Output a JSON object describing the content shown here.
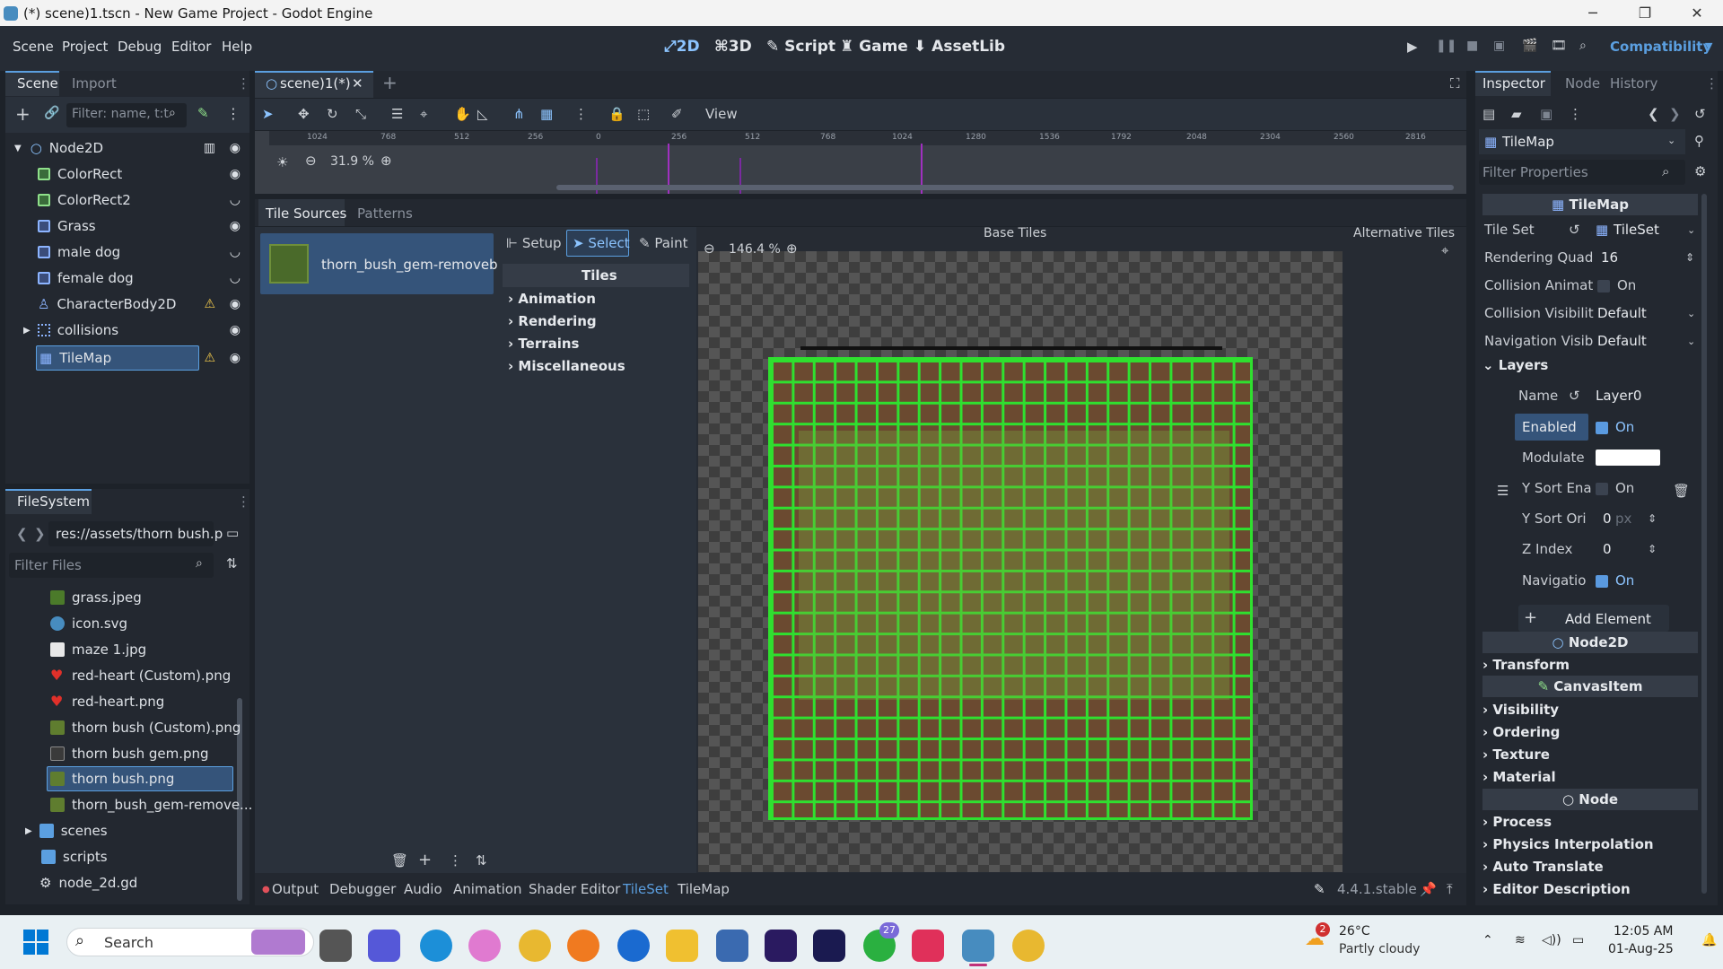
{
  "window": {
    "title": "(*) scene)1.tscn - New Game Project - Godot Engine"
  },
  "menu": [
    "Scene",
    "Project",
    "Debug",
    "Editor",
    "Help"
  ],
  "modes": {
    "m2d": "2D",
    "m3d": "3D",
    "script": "Script",
    "game": "Game",
    "assetlib": "AssetLib"
  },
  "renderer": "Compatibility",
  "scene_dock": {
    "tab_scene": "Scene",
    "tab_import": "Import",
    "filter_placeholder": "Filter: name, t:t",
    "nodes": [
      {
        "label": "Node2D"
      },
      {
        "label": "ColorRect"
      },
      {
        "label": "ColorRect2"
      },
      {
        "label": "Grass"
      },
      {
        "label": "male dog"
      },
      {
        "label": "female dog"
      },
      {
        "label": "CharacterBody2D"
      },
      {
        "label": "collisions"
      },
      {
        "label": "TileMap"
      }
    ]
  },
  "filesystem": {
    "title": "FileSystem",
    "path": "res://assets/thorn bush.p",
    "filter_placeholder": "Filter Files",
    "files": [
      {
        "label": "grass.jpeg"
      },
      {
        "label": "icon.svg"
      },
      {
        "label": "maze 1.jpg"
      },
      {
        "label": "red-heart (Custom).png"
      },
      {
        "label": "red-heart.png"
      },
      {
        "label": "thorn bush (Custom).png"
      },
      {
        "label": "thorn bush gem.png"
      },
      {
        "label": "thorn bush.png"
      },
      {
        "label": "thorn_bush_gem-remove..."
      },
      {
        "label": "scenes"
      },
      {
        "label": "scripts"
      },
      {
        "label": "node_2d.gd"
      }
    ]
  },
  "editor": {
    "tab": "scene)1(*)",
    "view": "View",
    "zoom": "31.9 %",
    "ruler": [
      "1024",
      "768",
      "512",
      "256",
      "0",
      "256",
      "512",
      "768",
      "1024",
      "1280",
      "1536",
      "1792",
      "2048",
      "2304",
      "2560",
      "2816"
    ]
  },
  "tileset": {
    "tab_sources": "Tile Sources",
    "tab_patterns": "Patterns",
    "source_name": "thorn_bush_gem-removeb...",
    "setup": "Setup",
    "select": "Select",
    "paint": "Paint",
    "tiles_header": "Tiles",
    "sections": [
      "Animation",
      "Rendering",
      "Terrains",
      "Miscellaneous"
    ],
    "zoom": "146.4 %",
    "base_tiles": "Base Tiles",
    "alt_tiles": "Alternative Tiles"
  },
  "bottom": {
    "tabs": [
      "Output",
      "Debugger",
      "Audio",
      "Animation",
      "Shader Editor",
      "TileSet",
      "TileMap"
    ],
    "version": "4.4.1.stable"
  },
  "inspector": {
    "tab_inspector": "Inspector",
    "tab_node": "Node",
    "tab_history": "History",
    "object": "TileMap",
    "filter_placeholder": "Filter Properties",
    "class": "TileMap",
    "tile_set_label": "Tile Set",
    "tile_set_value": "TileSet",
    "rq_label": "Rendering Quad",
    "rq_value": "16",
    "ca_label": "Collision Animat",
    "ca_value": "On",
    "cv_label": "Collision Visibilit",
    "cv_value": "Default",
    "nv_label": "Navigation Visib",
    "nv_value": "Default",
    "layers": "Layers",
    "name_label": "Name",
    "name_value": "Layer0",
    "enabled_label": "Enabled",
    "enabled_value": "On",
    "modulate_label": "Modulate",
    "ysort_label": "Y Sort Ena",
    "ysort_value": "On",
    "ysorto_label": "Y Sort Ori",
    "ysorto_value": "0",
    "ysorto_unit": "px",
    "zindex_label": "Z Index",
    "zindex_value": "0",
    "nav_label": "Navigatio",
    "nav_value": "On",
    "add_element": "Add Element",
    "node2d": "Node2D",
    "transform": "Transform",
    "canvasitem": "CanvasItem",
    "visibility": "Visibility",
    "ordering": "Ordering",
    "texture": "Texture",
    "material": "Material",
    "node": "Node",
    "process": "Process",
    "physics": "Physics Interpolation",
    "autotranslate": "Auto Translate",
    "editordesc": "Editor Description"
  },
  "taskbar": {
    "search": "Search",
    "temp": "26°C",
    "weather": "Partly cloudy",
    "weather_badge": "2",
    "time": "12:05 AM",
    "date": "01-Aug-25",
    "whatsapp_badge": "27"
  }
}
